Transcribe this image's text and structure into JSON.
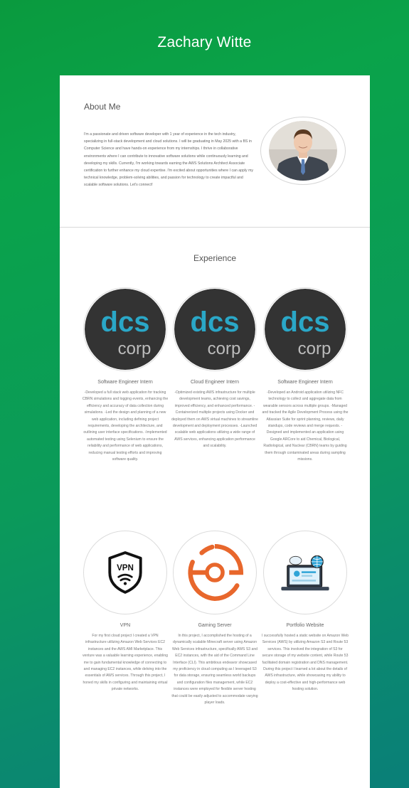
{
  "header": {
    "name": "Zachary Witte"
  },
  "about": {
    "heading": "About Me",
    "text": "I'm a passionate and driven software developer with 1 year of experience in the tech industry, specializing in full-stack development and cloud solutions. I will be graduating in May 2025 with a BS in Computer Science and have hands-on experience from my internships. I thrive in collaborative environments where I can contribute to innovative software solutions while continuously learning and developing my skills. Currently, I'm working towards earning the AWS Solutions Architect Associate certification to further enhance my cloud expertise. I'm excited about opportunities where I can apply my technical knowledge, problem-solving abilities, and passion for technology to create impactful and scalable software solutions. Let's connect!"
  },
  "experience": {
    "heading": "Experience",
    "items": [
      {
        "logo": "dcs-corp-logo",
        "title": "Software Engineer Intern",
        "description": "-Developed a full stack web application for tracking CBRN simulations and logging events, enhancing the efficiency and accuracy of data collection during simulations. -Led the design and planning of a new web application, including defining project requirements, developing the architecture, and outlining user interface specifications. -Implemented automated testing using Selenium to ensure the reliability and performance of web applications, reducing manual testing efforts and improving software quality."
      },
      {
        "logo": "dcs-corp-logo",
        "title": "Cloud Engineer Intern",
        "description": "-Optimized existing AWS infrastructure for multiple development teams, achieving cost savings, improved efficiency, and enhanced performance. -Containerized multiple projects using Docker and deployed them on AWS virtual machines to streamline development and deployment processes. -Launched scalable web applications utilizing a wide range of AWS services, enhancing application performance and scalability."
      },
      {
        "logo": "dcs-corp-logo",
        "title": "Software Engineer Intern",
        "description": "-Developed an Android application utilizing NFC technology to collect and aggregate data from wearable sensors across multiple groups. -Managed and tracked the Agile Development Process using the Atlassian Suite for sprint planning, reviews, daily standups, code reviews and merge requests. -Designed and implemented an application using Google ARCore to aid Chemical, Biological, Radiological, and Nuclear (CBRN) teams by guiding them through contaminated areas during sampling missions."
      }
    ]
  },
  "projects": {
    "items": [
      {
        "logo": "vpn-shield-icon",
        "logo_text": "VPN",
        "title": "VPN",
        "description": "For my first cloud project I created a VPN infrastructure utilizing Amazon Web Services EC2 instances and the AWS AMI Marketplace. This venture was a valuable learning experience, enabling me to gain fundamental knowledge of connecting to and managing EC2 instances, while delving into the essentials of AWS services. Through this project, I honed my skills in configuring and maintaining virtual private networks."
      },
      {
        "logo": "game-server-icon",
        "title": "Gaming Server",
        "description": "In this project, I accomplished the hosting of a dynamically scalable Minecraft server using Amazon Web Services infrastructure, specifically AWS S3 and EC2 instances, with the aid of the Command Line Interface (CLI). This ambitious endeavor showcased my proficiency in cloud computing as I leveraged S3 for data storage, ensuring seamless world backups and configuration files management, while EC2 instances were employed for flexible server hosting that could be easily adjusted to accommodate varying player loads."
      },
      {
        "logo": "website-monitor-icon",
        "title": "Portfolio Website",
        "description": "I successfully hosted a static website on Amazon Web Services (AWS) by utilizing Amazon S3 and Route 53 services. This involved the integration of S3 for secure storage of my website content, while Route 53 facilitated domain registration and DNS management. During this project I learned a lot about the details of AWS infrastructure, while showcasing my ability to deploy a cost-effective and high-performance web hosting solution."
      }
    ]
  },
  "colors": {
    "gradient_start": "#0a9a3e",
    "gradient_end": "#0a7f78",
    "dcs_blue": "#2aa7c7",
    "logo_dark": "#333333",
    "gaming_orange": "#e8672c",
    "card_bg": "#ffffff"
  }
}
